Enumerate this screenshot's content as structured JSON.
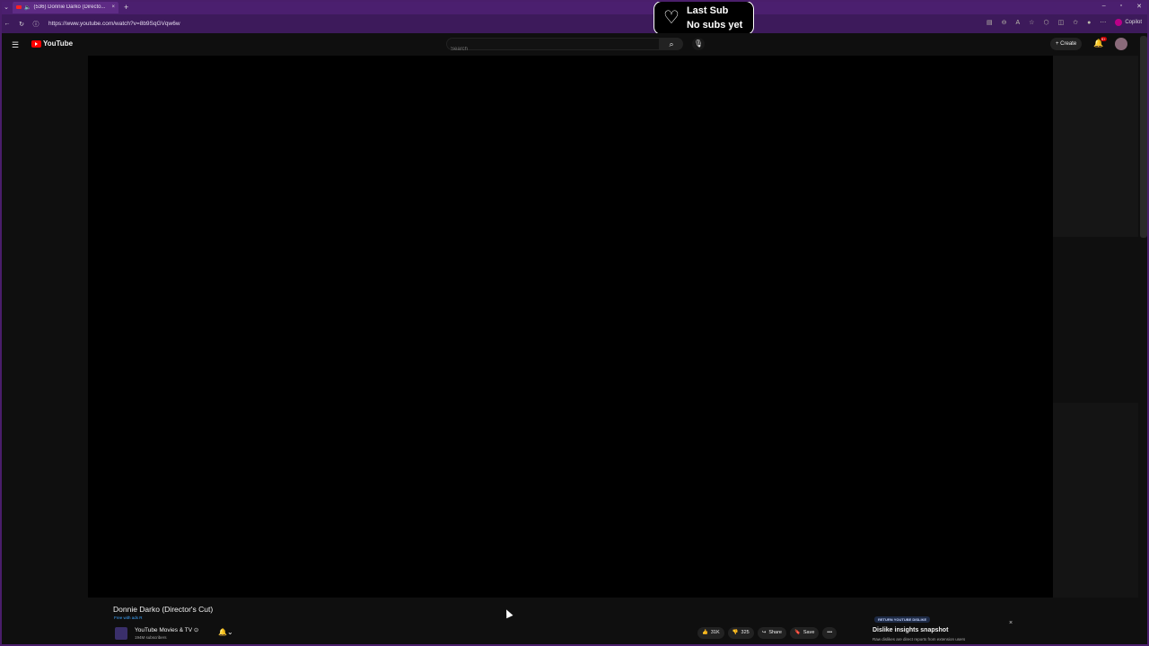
{
  "browser": {
    "tab_title": "(536) Donnie Darko (Directo...",
    "tab_close": "×",
    "new_tab": "+",
    "url": "https://www.youtube.com/watch?v=8b9SqGVqw6w",
    "copilot": "Copilot",
    "win_min": "–",
    "win_max": "▫",
    "win_close": "✕"
  },
  "overlay": {
    "line1": "Last Sub",
    "line2": "No subs yet"
  },
  "youtube": {
    "logo_text": "YouTube",
    "search_placeholder": "Search",
    "create_label": "+ Create",
    "notification_count": "9+"
  },
  "video": {
    "title": "Donnie Darko (Director's Cut)",
    "free_label": "Free with ads  R",
    "channel_name": "YouTube Movies & TV ⊙",
    "subscribers": "194M subscribers",
    "likes": "31K",
    "dislikes": "325",
    "share_label": "Share",
    "save_label": "Save",
    "more_label": "•••"
  },
  "dislike_card": {
    "badge": "RETURN YOUTUBE DISLIKE",
    "title": "Dislike insights snapshot",
    "subtitle": "Raw dislikes are direct reports from extension users",
    "close": "×"
  }
}
